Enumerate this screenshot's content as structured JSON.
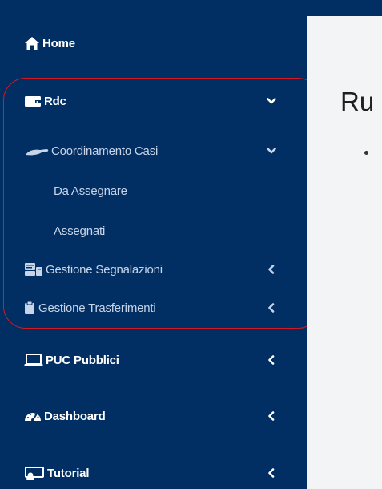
{
  "sidebar": {
    "home": {
      "label": "Home",
      "icon": "home-icon"
    },
    "rdc": {
      "label": "Rdc",
      "icon": "wallet-icon",
      "expanded": true
    },
    "coordinamento": {
      "label": "Coordinamento Casi",
      "icon": "hand-icon",
      "expanded": true
    },
    "da_assegnare": {
      "label": "Da Assegnare"
    },
    "assegnati": {
      "label": "Assegnati"
    },
    "segnalazioni": {
      "label": "Gestione Segnalazioni",
      "icon": "report-icon"
    },
    "trasferimenti": {
      "label": "Gestione Trasferimenti",
      "icon": "clipboard-icon"
    },
    "puc": {
      "label": "PUC Pubblici",
      "icon": "laptop-icon"
    },
    "dashboard": {
      "label": "Dashboard",
      "icon": "gauge-icon"
    },
    "tutorial": {
      "label": "Tutorial",
      "icon": "projector-icon"
    }
  },
  "content": {
    "title_fragment": "Ru"
  },
  "colors": {
    "sidebar_bg": "#022f63",
    "annotation_red": "#d7191f",
    "content_bg": "#f3f4f6"
  }
}
